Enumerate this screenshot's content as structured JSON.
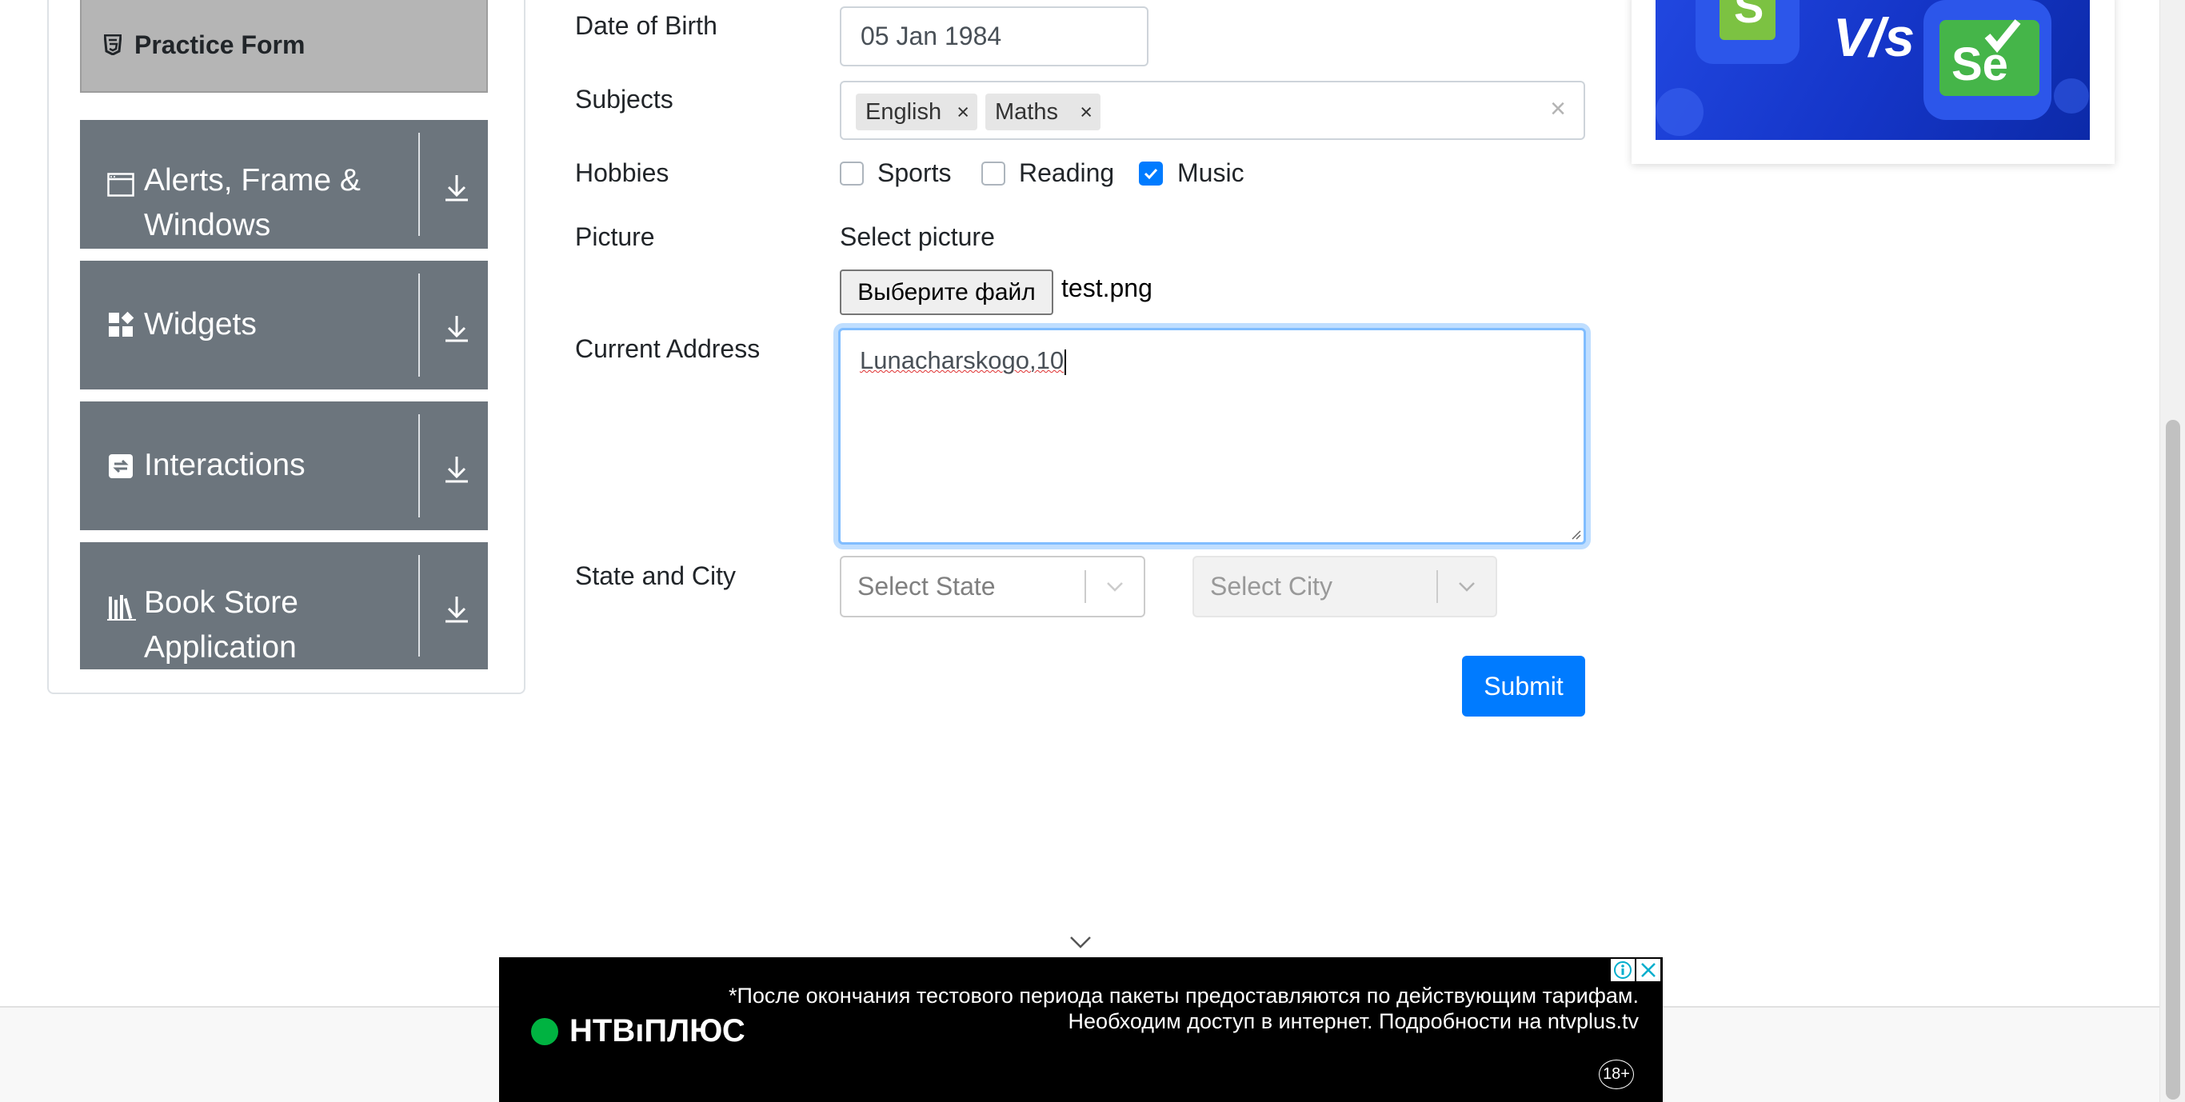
{
  "sidebar": {
    "practice_form": "Practice Form",
    "groups": [
      {
        "label": "Alerts, Frame & Windows",
        "icon": "window-icon"
      },
      {
        "label": "Widgets",
        "icon": "widgets-icon"
      },
      {
        "label": "Interactions",
        "icon": "interactions-icon"
      },
      {
        "label": "Book Store Application",
        "icon": "books-icon"
      }
    ]
  },
  "form": {
    "dob_label": "Date of Birth",
    "dob_value": "05 Jan 1984",
    "subjects_label": "Subjects",
    "subjects": [
      "English",
      "Maths"
    ],
    "chip_remove": "×",
    "clear_all": "×",
    "hobbies_label": "Hobbies",
    "hobbies": [
      {
        "label": "Sports",
        "checked": false
      },
      {
        "label": "Reading",
        "checked": false
      },
      {
        "label": "Music",
        "checked": true
      }
    ],
    "picture_label": "Picture",
    "select_picture": "Select picture",
    "file_button": "Выберите файл",
    "file_name": "test.png",
    "address_label": "Current Address",
    "address_value": "Lunacharskogo,10",
    "state_city_label": "State and City",
    "state_placeholder": "Select State",
    "city_placeholder": "Select City",
    "submit": "Submit"
  },
  "banner": {
    "vs_text": "V/s",
    "se_text": "Se"
  },
  "ad": {
    "logo": "НТВıПЛЮС",
    "line1": "*После окончания тестового периода пакеты предоставляются по действующим тарифам.",
    "line2": "Необходим доступ в интернет. Подробности на ntvplus.tv",
    "age": "18+"
  },
  "colors": {
    "accent": "#007bff",
    "sidebar_group": "#6c757d",
    "practice_active": "#b5b5b5"
  }
}
